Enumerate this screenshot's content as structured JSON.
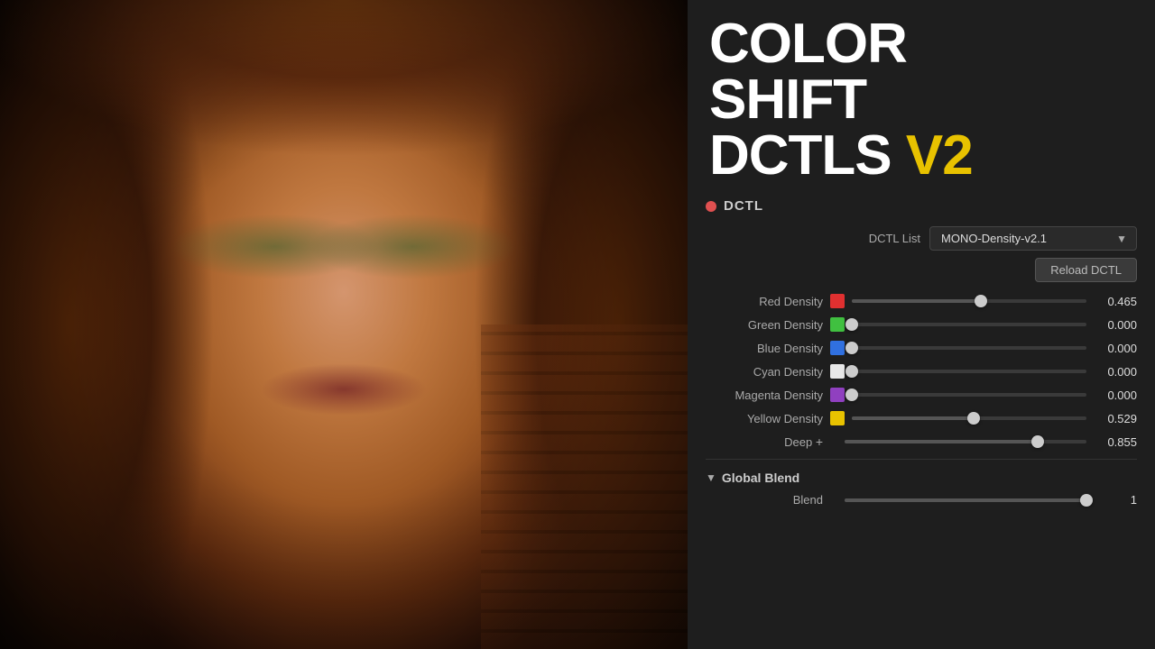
{
  "title": {
    "line1": "COLOR",
    "line2": "SHIFT",
    "line3_main": "DCTLS",
    "line3_accent": "V2"
  },
  "dctl": {
    "label": "DCTL",
    "list_label": "DCTL List",
    "list_value": "MONO-Density-v2.1",
    "reload_label": "Reload DCTL"
  },
  "sliders": [
    {
      "label": "Red Density",
      "color": "#e03030",
      "value": 0.465,
      "percent": 55,
      "id": "red-density"
    },
    {
      "label": "Green Density",
      "color": "#40c040",
      "value": 0.0,
      "percent": 0,
      "id": "green-density"
    },
    {
      "label": "Blue Density",
      "color": "#3070e0",
      "value": 0.0,
      "percent": 0,
      "id": "blue-density"
    },
    {
      "label": "Cyan Density",
      "color": "#e8e8e8",
      "value": 0.0,
      "percent": 0,
      "id": "cyan-density"
    },
    {
      "label": "Magenta Density",
      "color": "#9040c0",
      "value": 0.0,
      "percent": 0,
      "id": "magenta-density"
    },
    {
      "label": "Yellow Density",
      "color": "#e8c200",
      "value": 0.529,
      "percent": 52,
      "id": "yellow-density"
    }
  ],
  "deep": {
    "label": "Deep",
    "value": 0.855,
    "percent": 80
  },
  "global_blend": {
    "section_label": "Global Blend",
    "blend_label": "Blend",
    "blend_value": 1.0,
    "blend_percent": 100
  }
}
